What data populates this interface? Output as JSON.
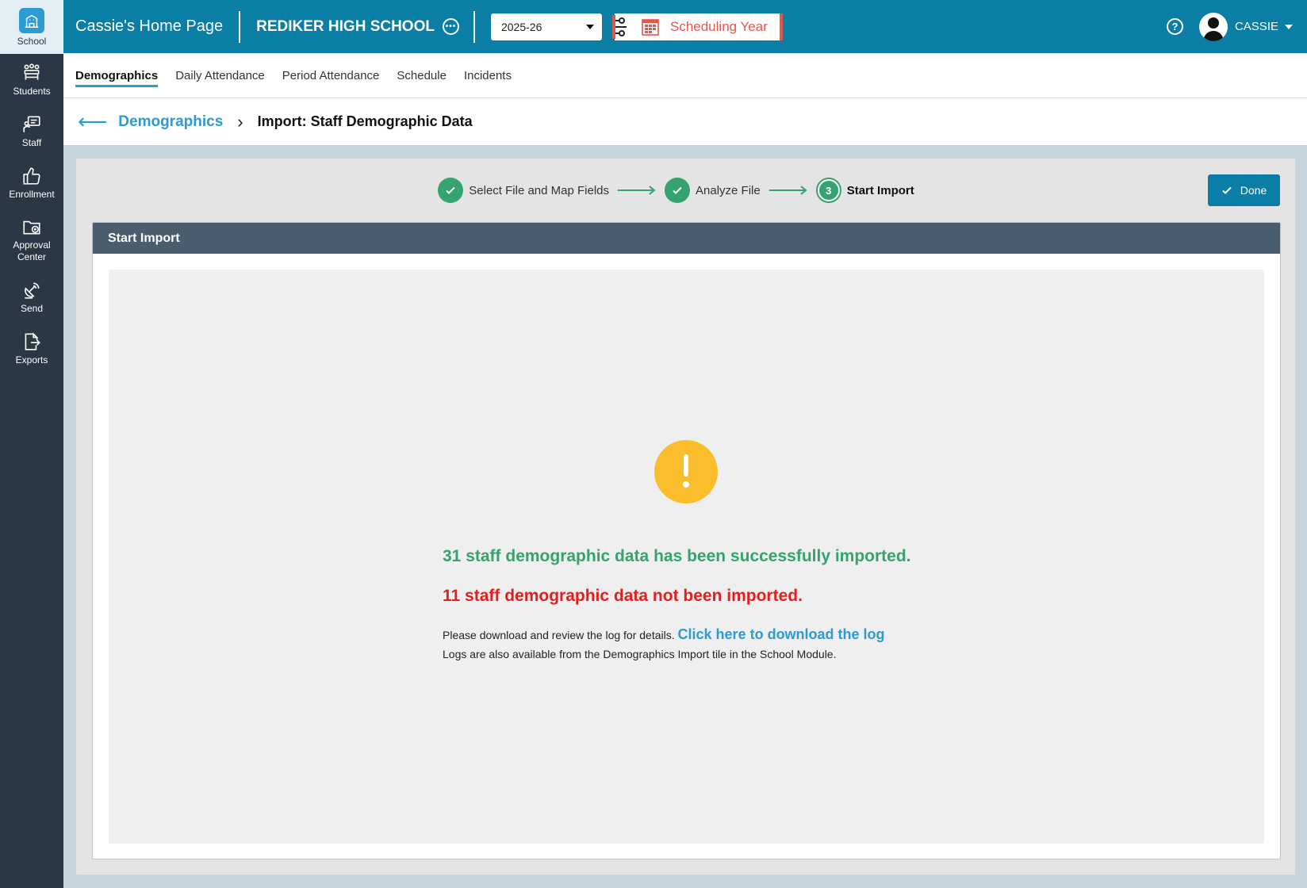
{
  "sidebar": {
    "items": [
      {
        "label": "School",
        "icon": "school-icon"
      },
      {
        "label": "Students",
        "icon": "students-icon"
      },
      {
        "label": "Staff",
        "icon": "staff-icon"
      },
      {
        "label": "Enrollment",
        "icon": "thumbs-up-icon"
      },
      {
        "label": "Approval Center",
        "icon": "folder-add-icon"
      },
      {
        "label": "Send",
        "icon": "satellite-icon"
      },
      {
        "label": "Exports",
        "icon": "export-file-icon"
      }
    ]
  },
  "header": {
    "home_title": "Cassie's Home Page",
    "school_name": "REDIKER HIGH SCHOOL",
    "school_year": "2025-26",
    "scheduling_label": "Scheduling Year",
    "user_name": "CASSIE",
    "help_icon": "?"
  },
  "subnav": {
    "tabs": [
      "Demographics",
      "Daily Attendance",
      "Period Attendance",
      "Schedule",
      "Incidents"
    ],
    "active": "Demographics"
  },
  "breadcrumb": {
    "back_arrow": "⟵",
    "parent": "Demographics",
    "separator": "›",
    "current": "Import: Staff Demographic Data"
  },
  "wizard": {
    "steps": [
      {
        "label": "Select File and Map Fields",
        "status": "complete"
      },
      {
        "label": "Analyze File",
        "status": "complete"
      },
      {
        "label": "Start Import",
        "status": "current",
        "number": "3"
      }
    ],
    "done_label": "Done"
  },
  "panel": {
    "title": "Start Import",
    "success_message": "31 staff demographic data has been successfully imported.",
    "fail_message": "11 staff demographic data not been imported.",
    "log_prompt": "Please download and review the log for details.",
    "log_link": "Click here to download the log",
    "log_note": "Logs are also available from the Demographics Import tile in the School Module."
  },
  "colors": {
    "topbar": "#0b7ea6",
    "sidebar": "#2a3744",
    "accent": "#2b9bd1",
    "success": "#34a36f",
    "error": "#e51d1d",
    "warning": "#fbbd2b",
    "panel_header": "#4a5d6e"
  }
}
